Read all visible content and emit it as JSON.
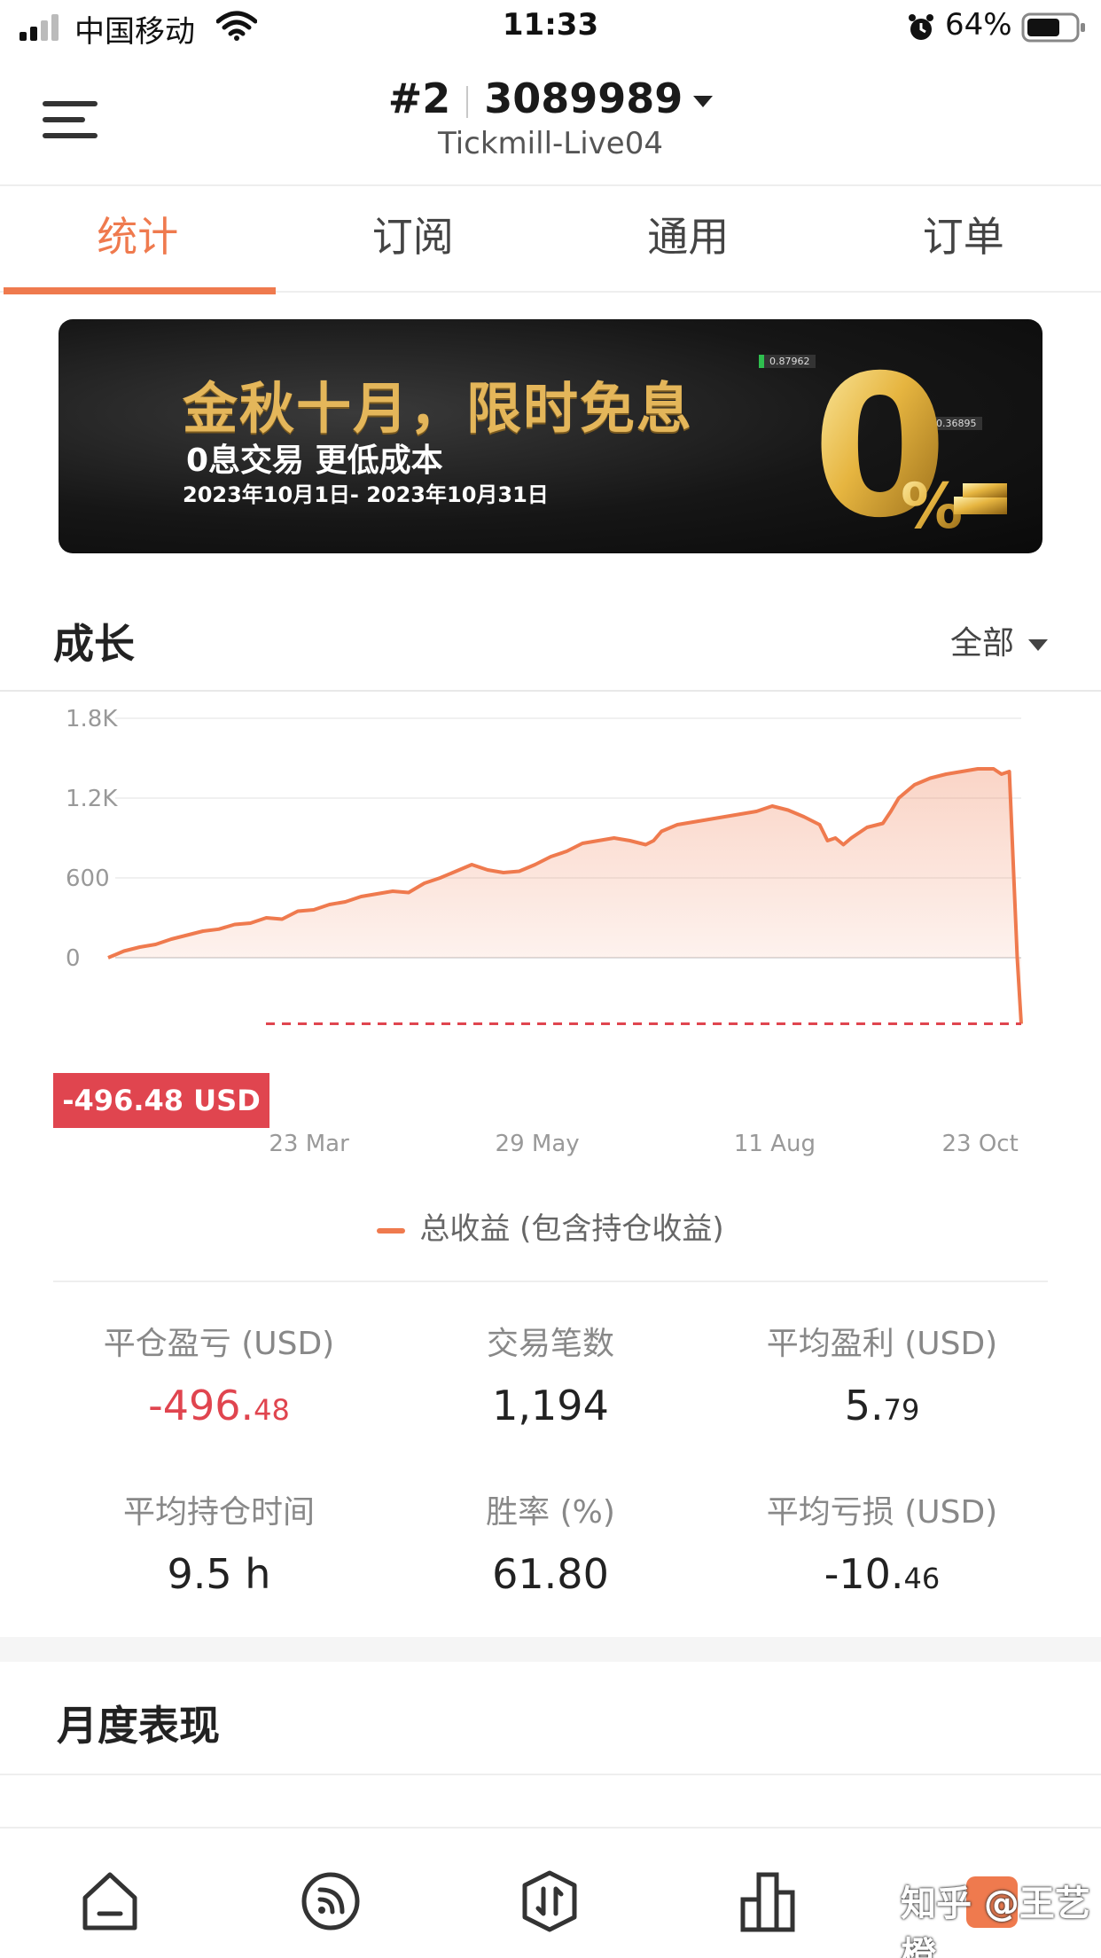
{
  "status_bar": {
    "carrier": "中国移动",
    "time": "11:33",
    "battery": "64%"
  },
  "header": {
    "account_index": "#2",
    "account_number": "3089989",
    "server": "Tickmill-Live04"
  },
  "tabs": [
    {
      "label": "统计",
      "active": true
    },
    {
      "label": "订阅",
      "active": false
    },
    {
      "label": "通用",
      "active": false
    },
    {
      "label": "订单",
      "active": false
    }
  ],
  "banner": {
    "title": "金秋十月，限时免息",
    "subtitle": "0息交易 更低成本",
    "date_range": "2023年10月1日- 2023年10月31日",
    "big_text": "0",
    "percent": "%",
    "tag_1": "0.87962",
    "tag_2": "0.36895"
  },
  "growth": {
    "title": "成长",
    "filter": "全部"
  },
  "chart_data": {
    "type": "area",
    "y_ticks": [
      "1.8K",
      "1.2K",
      "600",
      "0"
    ],
    "x_ticks": [
      "23 Mar",
      "29 May",
      "11 Aug",
      "23 Oct"
    ],
    "ylim": [
      -600,
      1800
    ],
    "legend": "总收益 (包含持仓收益)",
    "final_value_label": "-496.48 USD",
    "final_value": -496.48,
    "series": [
      {
        "name": "总收益 (包含持仓收益)",
        "points": [
          [
            0,
            0
          ],
          [
            2,
            50
          ],
          [
            4,
            80
          ],
          [
            6,
            100
          ],
          [
            8,
            140
          ],
          [
            10,
            170
          ],
          [
            12,
            200
          ],
          [
            14,
            215
          ],
          [
            16,
            250
          ],
          [
            18,
            260
          ],
          [
            20,
            300
          ],
          [
            22,
            290
          ],
          [
            24,
            350
          ],
          [
            26,
            360
          ],
          [
            28,
            400
          ],
          [
            30,
            420
          ],
          [
            32,
            460
          ],
          [
            34,
            480
          ],
          [
            36,
            500
          ],
          [
            38,
            490
          ],
          [
            40,
            560
          ],
          [
            42,
            600
          ],
          [
            44,
            650
          ],
          [
            46,
            700
          ],
          [
            48,
            660
          ],
          [
            50,
            640
          ],
          [
            52,
            650
          ],
          [
            54,
            700
          ],
          [
            56,
            760
          ],
          [
            58,
            800
          ],
          [
            60,
            860
          ],
          [
            62,
            880
          ],
          [
            64,
            900
          ],
          [
            66,
            880
          ],
          [
            68,
            850
          ],
          [
            69,
            880
          ],
          [
            70,
            950
          ],
          [
            72,
            1000
          ],
          [
            74,
            1020
          ],
          [
            76,
            1040
          ],
          [
            78,
            1060
          ],
          [
            80,
            1080
          ],
          [
            82,
            1100
          ],
          [
            84,
            1140
          ],
          [
            86,
            1110
          ],
          [
            88,
            1060
          ],
          [
            90,
            1000
          ],
          [
            91,
            880
          ],
          [
            92,
            900
          ],
          [
            93,
            850
          ],
          [
            94,
            900
          ],
          [
            96,
            980
          ],
          [
            98,
            1010
          ],
          [
            99,
            1100
          ],
          [
            100,
            1200
          ],
          [
            102,
            1300
          ],
          [
            104,
            1350
          ],
          [
            106,
            1380
          ],
          [
            108,
            1400
          ],
          [
            110,
            1420
          ],
          [
            112,
            1420
          ],
          [
            113,
            1380
          ],
          [
            114,
            1400
          ],
          [
            115,
            0
          ],
          [
            115.5,
            -496.48
          ]
        ]
      }
    ]
  },
  "stats": [
    {
      "label": "平仓盈亏 (USD)",
      "value_main": "-496.",
      "value_dec": "48",
      "negative": true
    },
    {
      "label": "交易笔数",
      "value_main": "1,194",
      "value_dec": "",
      "negative": false
    },
    {
      "label": "平均盈利 (USD)",
      "value_main": "5.",
      "value_dec": "79",
      "negative": false
    },
    {
      "label": "平均持仓时间",
      "value_main": "9.5 h",
      "value_dec": "",
      "negative": false
    },
    {
      "label": "胜率 (%)",
      "value_main": "61.80",
      "value_dec": "",
      "negative": false
    },
    {
      "label": "平均亏损 (USD)",
      "value_main": "-10.",
      "value_dec": "46",
      "negative": false
    }
  ],
  "monthly": {
    "title": "月度表现"
  },
  "watermark": "知乎 @王艺橙",
  "colors": {
    "accent": "#ef7a4e",
    "negative": "#e0454f"
  }
}
